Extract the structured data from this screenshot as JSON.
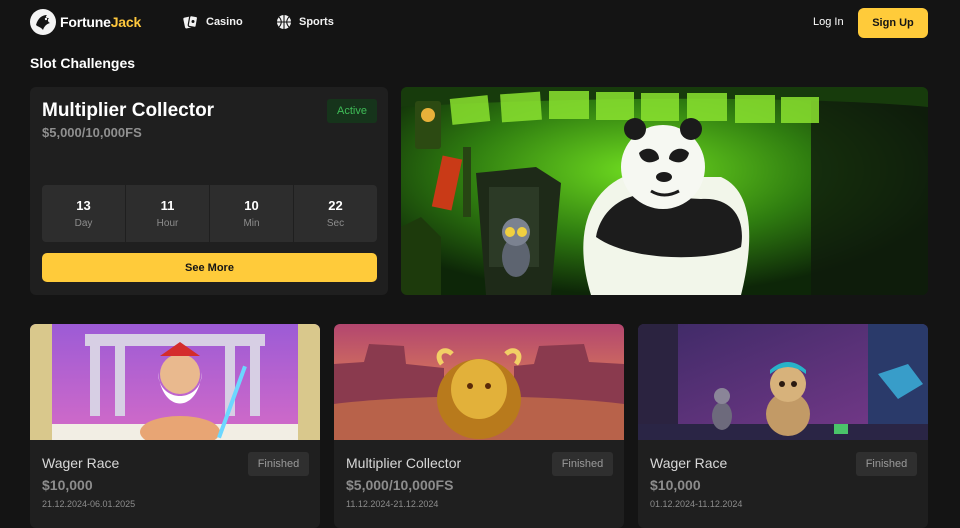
{
  "header": {
    "logo_part1": "Fortune",
    "logo_part2": "Jack",
    "nav": [
      {
        "label": "Casino",
        "icon": "cards-icon"
      },
      {
        "label": "Sports",
        "icon": "basketball-icon"
      }
    ],
    "login_label": "Log In",
    "signup_label": "Sign Up"
  },
  "section_title": "Slot Challenges",
  "featured": {
    "title": "Multiplier Collector",
    "prize": "$5,000/10,000FS",
    "status": "Active",
    "countdown": [
      {
        "value": "13",
        "unit": "Day"
      },
      {
        "value": "11",
        "unit": "Hour"
      },
      {
        "value": "10",
        "unit": "Min"
      },
      {
        "value": "22",
        "unit": "Sec"
      }
    ],
    "cta_label": "See More"
  },
  "cards": [
    {
      "title": "Wager Race",
      "prize": "$10,000",
      "dates": "21.12.2024-06.01.2025",
      "status": "Finished"
    },
    {
      "title": "Multiplier Collector",
      "prize": "$5,000/10,000FS",
      "dates": "11.12.2024-21.12.2024",
      "status": "Finished"
    },
    {
      "title": "Wager Race",
      "prize": "$10,000",
      "dates": "01.12.2024-11.12.2024",
      "status": "Finished"
    }
  ],
  "colors": {
    "accent": "#ffcb3a",
    "background": "#141414",
    "card": "#1f1f1f",
    "active_text": "#3fbc57",
    "active_bg": "#16341b"
  }
}
